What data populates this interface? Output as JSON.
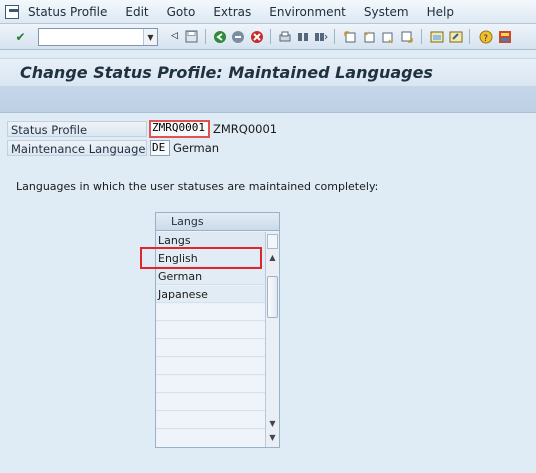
{
  "menu": {
    "items": [
      "Status Profile",
      "Edit",
      "Goto",
      "Extras",
      "Environment",
      "System",
      "Help"
    ]
  },
  "toolbar": {
    "okcode_value": "",
    "icons": [
      "enter-icon",
      "back-icon",
      "save-icon",
      "back-green-icon",
      "exit-icon",
      "cancel-icon",
      "print-icon",
      "find-icon",
      "find-next-icon",
      "first-page-icon",
      "previous-page-icon",
      "next-page-icon",
      "last-page-icon",
      "create-session-icon",
      "shortcut-icon",
      "help-icon",
      "layout-icon"
    ]
  },
  "title": "Change Status Profile: Maintained Languages",
  "form": {
    "status_profile_label": "Status Profile",
    "status_profile_value": "ZMRQ0001",
    "status_profile_text": "ZMRQ0001",
    "maintenance_language_label": "Maintenance Language",
    "maintenance_language_value": "DE",
    "maintenance_language_text": "German"
  },
  "info_text": "Languages in which the user statuses are maintained completely:",
  "table": {
    "header": "Langs",
    "rows": [
      "Langs",
      "English",
      "German",
      "Japanese"
    ]
  },
  "colors": {
    "highlight": "#e0262b",
    "background": "#dfebf5"
  }
}
